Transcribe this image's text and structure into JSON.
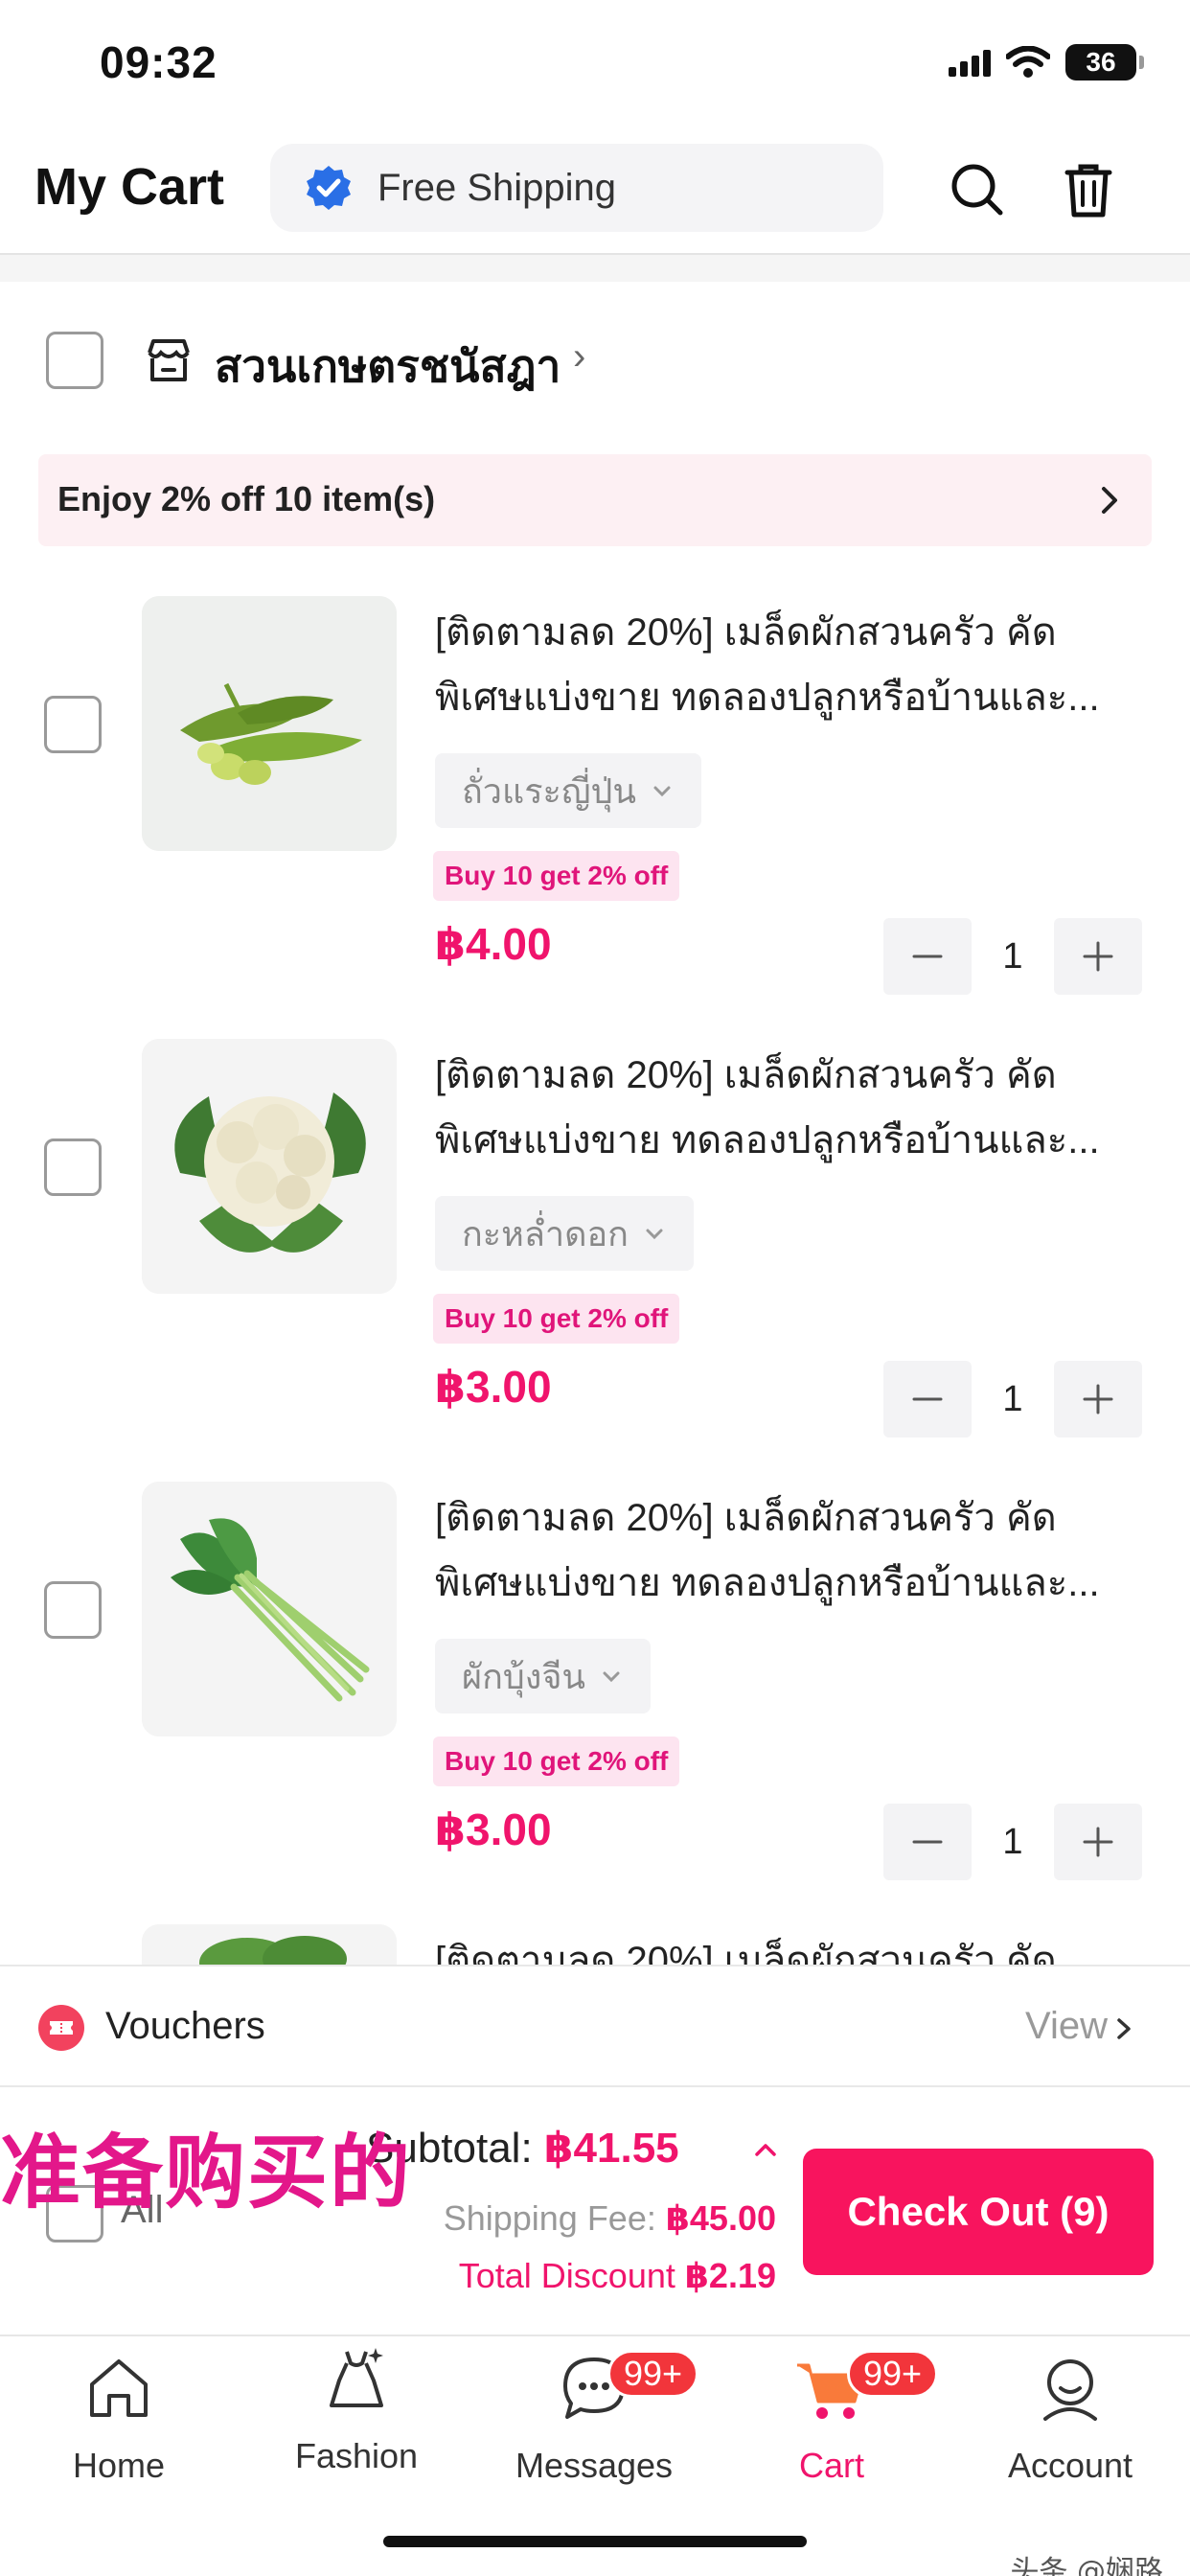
{
  "status_bar": {
    "time": "09:32",
    "battery": "36"
  },
  "header": {
    "title": "My Cart",
    "free_shipping_label": "Free Shipping"
  },
  "store": {
    "name": "สวนเกษตรชนัสฎา",
    "chevron": "›",
    "promo": "Enjoy 2% off 10 item(s)"
  },
  "items": [
    {
      "title": "[ติดตามลด 20%] เมล็ดผักสวนครัว คัดพิเศษแบ่งขาย ทดลองปลูกหรือบ้านและ...",
      "variant": "ถั่วแระญี่ปุ่น",
      "deal": "Buy 10 get 2% off",
      "price": "฿4.00",
      "qty": "1",
      "image_icon": "edamame-image"
    },
    {
      "title": "[ติดตามลด 20%] เมล็ดผักสวนครัว คัดพิเศษแบ่งขาย ทดลองปลูกหรือบ้านและ...",
      "variant": "กะหล่ำดอก",
      "deal": "Buy 10 get 2% off",
      "price": "฿3.00",
      "qty": "1",
      "image_icon": "cauliflower-image"
    },
    {
      "title": "[ติดตามลด 20%] เมล็ดผักสวนครัว คัดพิเศษแบ่งขาย ทดลองปลูกหรือบ้านและ...",
      "variant": "ผักบุ้งจีน",
      "deal": "Buy 10 get 2% off",
      "price": "฿3.00",
      "qty": "1",
      "image_icon": "morning-glory-image"
    },
    {
      "title": "[ติดตามลด 20%] เมล็ดผักสวนครัว คัด"
    }
  ],
  "vouchers": {
    "label": "Vouchers",
    "view": "View"
  },
  "checkout": {
    "watermark": "准备购买的",
    "all_label": "All",
    "subtotal_label": "Subtotal: ",
    "subtotal_value": "฿41.55",
    "shipping_label": "Shipping Fee: ",
    "shipping_value": "฿45.00",
    "discount_label": "Total Discount ",
    "discount_value": "฿2.19",
    "button": "Check Out (9)"
  },
  "tabs": [
    {
      "label": "Home",
      "icon": "home-icon"
    },
    {
      "label": "Fashion",
      "icon": "dress-icon"
    },
    {
      "label": "Messages",
      "icon": "chat-icon",
      "badge": "99+"
    },
    {
      "label": "Cart",
      "icon": "cart-icon",
      "badge": "99+"
    },
    {
      "label": "Account",
      "icon": "user-icon"
    }
  ],
  "corner_mark": "头条 @娴路",
  "colors": {
    "accent": "#f0146c",
    "checkout": "#f8145e",
    "badge": "#f2353b",
    "promo_bg": "#fdf0f3"
  }
}
